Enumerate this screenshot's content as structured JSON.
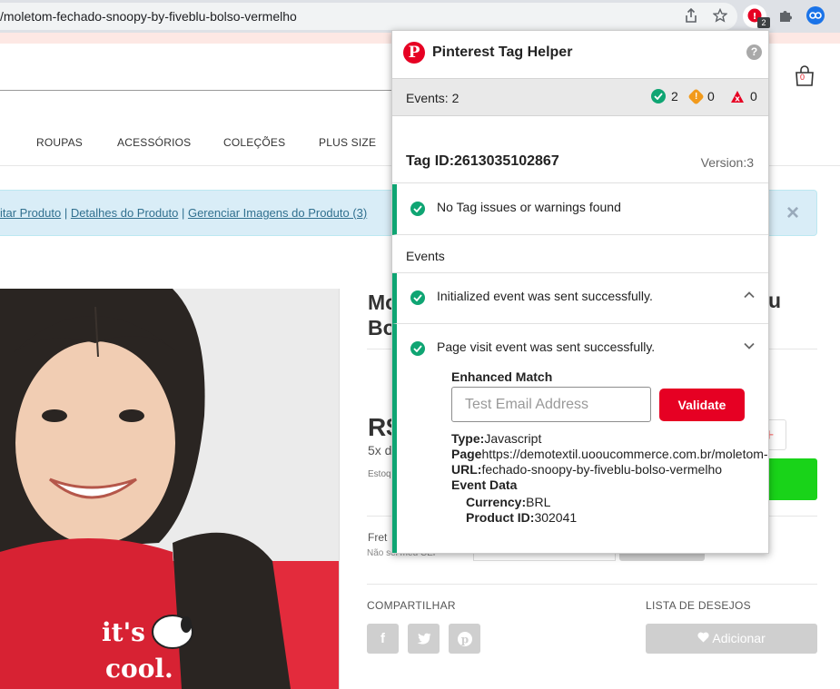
{
  "browser": {
    "url": "/moletom-fechado-snoopy-by-fiveblu-bolso-vermelho",
    "extension_badge": "2"
  },
  "site": {
    "nav": [
      "ROUPAS",
      "ACESSÓRIOS",
      "COLEÇÕES",
      "PLUS SIZE"
    ],
    "cart_count": "0",
    "admin_links": [
      "itar Produto",
      "Detalhes do Produto",
      "Gerenciar Imagens do Produto (3)"
    ],
    "admin_close": "×",
    "title_fragment_line1": "Mo",
    "title_fragment_line2": "Bo",
    "title_fragment_right": "u",
    "price_fragment": "R$",
    "installments_fragment": "5x d",
    "stock_fragment": "Estoq",
    "frete_fragment": "Fret",
    "cep_fragment": "Não sei meu CEP",
    "share_label": "COMPARTILHAR",
    "wishlist_label": "LISTA DE DESEJOS",
    "wishlist_button": "Adicionar",
    "share_icons": [
      "f",
      "twitter-icon",
      "pinterest-icon"
    ],
    "shirt_text_1": "it's",
    "shirt_text_2": "cool."
  },
  "popup": {
    "title": "Pinterest Tag Helper",
    "help": "?",
    "events_label": "Events: 2",
    "counts": {
      "success": "2",
      "warning": "0",
      "error": "0"
    },
    "tag_id": "Tag ID:2613035102867",
    "version": "Version:3",
    "no_issues": "No Tag issues or warnings found",
    "events_heading": "Events",
    "event1": "Initialized event was sent successfully.",
    "event2": "Page visit event was sent successfully.",
    "enhanced_match_label": "Enhanced Match",
    "email_placeholder": "Test Email Address",
    "validate_button": "Validate",
    "type_label": "Type:",
    "type_value": "Javascript",
    "page_label": "Page",
    "page_value": "https://demotextil.uooucommerce.com.br/moletom-",
    "url_label": "URL:",
    "url_value": "fechado-snoopy-by-fiveblu-bolso-vermelho",
    "event_data_label": "Event Data",
    "currency_label": "Currency:",
    "currency_value": "BRL",
    "product_id_label": "Product ID:",
    "product_id_value": "302041"
  },
  "colors": {
    "pinterest_red": "#e60023",
    "success_green": "#0fa573",
    "warning_orange": "#f29a1b",
    "error_red": "#e60023",
    "buy_green": "#19d319"
  }
}
